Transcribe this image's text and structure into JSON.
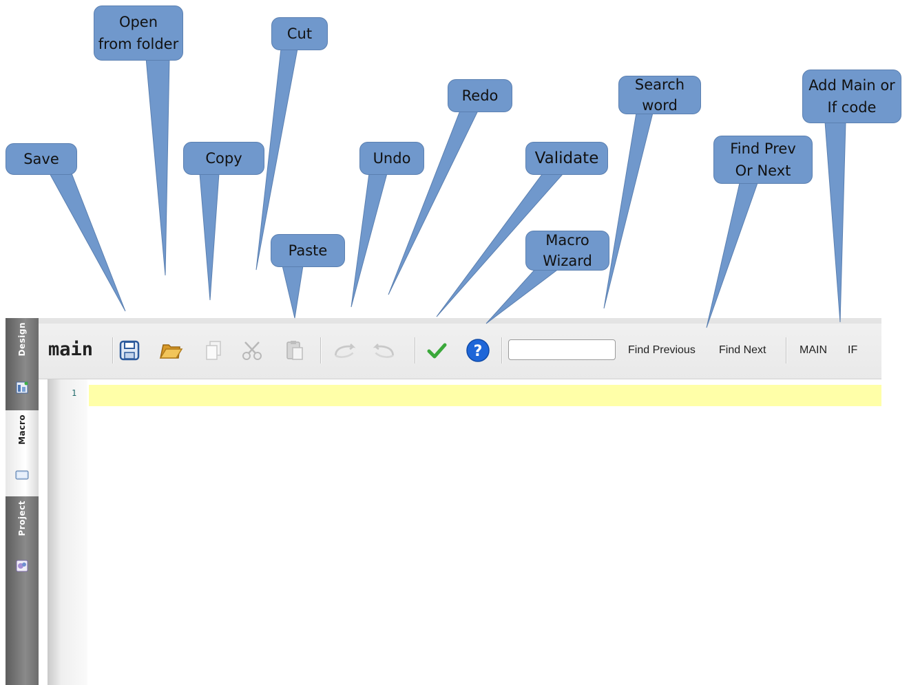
{
  "callouts": [
    {
      "id": "save",
      "text": "Save"
    },
    {
      "id": "open",
      "text": "Open\nfrom folder"
    },
    {
      "id": "copy",
      "text": "Copy"
    },
    {
      "id": "cut",
      "text": "Cut"
    },
    {
      "id": "paste",
      "text": "Paste"
    },
    {
      "id": "undo",
      "text": "Undo"
    },
    {
      "id": "redo",
      "text": "Redo"
    },
    {
      "id": "validate",
      "text": "Validate"
    },
    {
      "id": "wizard",
      "text": "Macro\nWizard"
    },
    {
      "id": "search",
      "text": "Search\nword"
    },
    {
      "id": "find",
      "text": "Find Prev\nOr Next"
    },
    {
      "id": "addcode",
      "text": "Add Main or\nIf code"
    }
  ],
  "sidebar": {
    "tabs": [
      {
        "label": "Design",
        "icon": "design-icon"
      },
      {
        "label": "Macro",
        "icon": "macro-icon",
        "active": true
      },
      {
        "label": "Project",
        "icon": "project-icon"
      }
    ]
  },
  "toolbar": {
    "file_name": "main",
    "icons": [
      "save-icon",
      "open-folder-icon",
      "copy-icon",
      "cut-icon",
      "paste-icon",
      "undo-icon",
      "redo-icon",
      "validate-check-icon",
      "macro-wizard-question-icon"
    ],
    "search_value": "",
    "find_previous_label": "Find Previous",
    "find_next_label": "Find Next",
    "main_label": "MAIN",
    "if_label": "IF"
  },
  "editor": {
    "line_numbers": [
      "1"
    ],
    "current_line_color": "#ffffa8"
  },
  "colors": {
    "callout_fill": "#7098cc",
    "callout_border": "#5a7fb0"
  }
}
